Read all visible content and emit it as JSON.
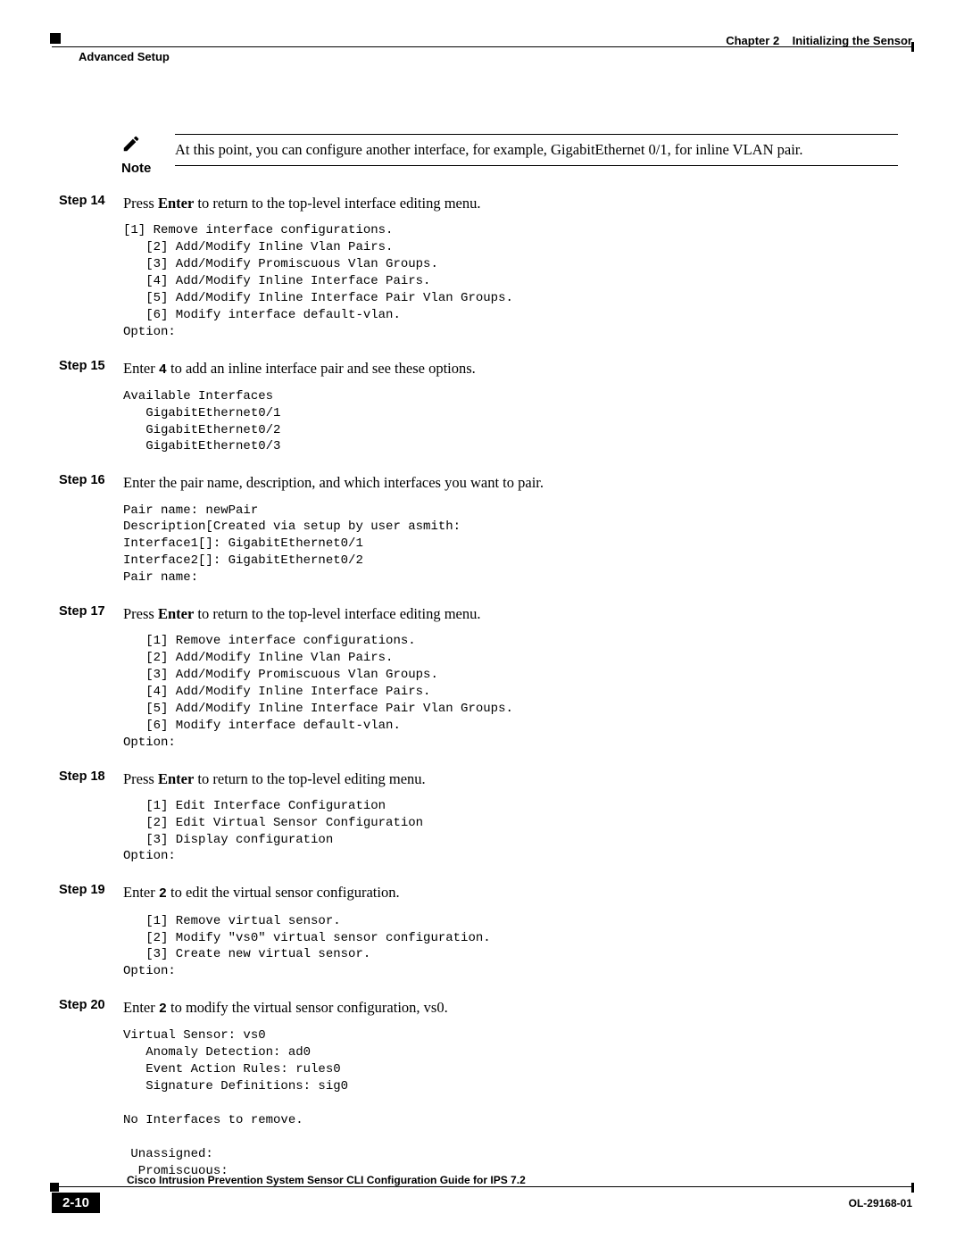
{
  "header": {
    "chapter_label": "Chapter 2",
    "chapter_title": "Initializing the Sensor",
    "section": "Advanced Setup"
  },
  "note": {
    "label": "Note",
    "text": "At this point, you can configure another interface, for example, GigabitEthernet 0/1, for inline VLAN pair."
  },
  "steps": [
    {
      "label": "Step 14",
      "pre": "Press ",
      "kbd": "Enter",
      "post": " to return to the top-level interface editing menu.",
      "console": "[1] Remove interface configurations.\n   [2] Add/Modify Inline Vlan Pairs.\n   [3] Add/Modify Promiscuous Vlan Groups.\n   [4] Add/Modify Inline Interface Pairs.\n   [5] Add/Modify Inline Interface Pair Vlan Groups.\n   [6] Modify interface default-vlan.\nOption:"
    },
    {
      "label": "Step 15",
      "pre": "Enter ",
      "tt": "4",
      "post": " to add an inline interface pair and see these options.",
      "console": "Available Interfaces\n   GigabitEthernet0/1\n   GigabitEthernet0/2\n   GigabitEthernet0/3"
    },
    {
      "label": "Step 16",
      "plain": "Enter the pair name, description, and which interfaces you want to pair.",
      "console": "Pair name: newPair\nDescription[Created via setup by user asmith: \nInterface1[]: GigabitEthernet0/1\nInterface2[]: GigabitEthernet0/2\nPair name:"
    },
    {
      "label": "Step 17",
      "pre": "Press ",
      "kbd": "Enter",
      "post": " to return to the top-level interface editing menu.",
      "console": "   [1] Remove interface configurations.\n   [2] Add/Modify Inline Vlan Pairs.\n   [3] Add/Modify Promiscuous Vlan Groups.\n   [4] Add/Modify Inline Interface Pairs.\n   [5] Add/Modify Inline Interface Pair Vlan Groups.\n   [6] Modify interface default-vlan.\nOption:"
    },
    {
      "label": "Step 18",
      "pre": "Press ",
      "kbd": "Enter",
      "post": " to return to the top-level editing menu.",
      "console": "   [1] Edit Interface Configuration\n   [2] Edit Virtual Sensor Configuration\n   [3] Display configuration\nOption:"
    },
    {
      "label": "Step 19",
      "pre": "Enter ",
      "tt": "2",
      "post": " to edit the virtual sensor configuration.",
      "console": "   [1] Remove virtual sensor.\n   [2] Modify \"vs0\" virtual sensor configuration.\n   [3] Create new virtual sensor.\nOption:"
    },
    {
      "label": "Step 20",
      "pre": "Enter ",
      "tt": "2",
      "post": " to modify the virtual sensor configuration, vs0.",
      "console": "Virtual Sensor: vs0\n   Anomaly Detection: ad0\n   Event Action Rules: rules0\n   Signature Definitions: sig0\n\nNo Interfaces to remove.\n\n Unassigned:\n  Promiscuous:"
    }
  ],
  "footer": {
    "title": "Cisco Intrusion Prevention System Sensor CLI Configuration Guide for IPS 7.2",
    "page": "2-10",
    "docid": "OL-29168-01"
  }
}
